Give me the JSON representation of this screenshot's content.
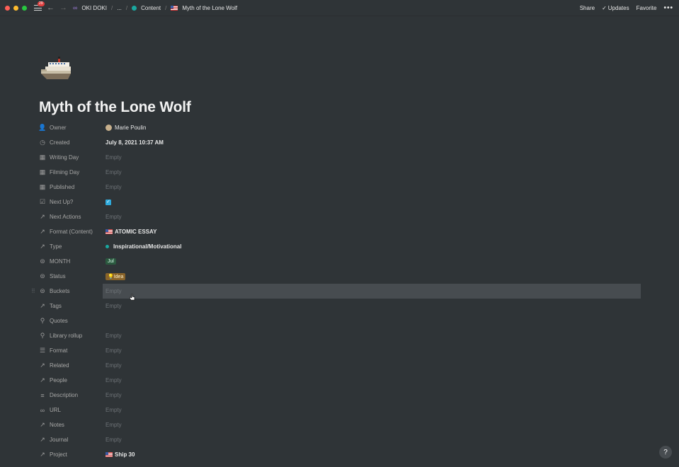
{
  "topbar": {
    "badge": "29",
    "workspace": "OKI DOKI",
    "ellipsis": "...",
    "separator": "/",
    "crumb_content": "Content",
    "crumb_page": "Myth of the Lone Wolf",
    "actions": {
      "share": "Share",
      "updates": "Updates",
      "favorite": "Favorite",
      "more": "•••"
    }
  },
  "page": {
    "icon": "ship-emoji-icon",
    "title": "Myth of the Lone Wolf"
  },
  "properties": [
    {
      "name": "Owner",
      "icon": "person-icon",
      "value": "Marie Poulin",
      "kind": "person"
    },
    {
      "name": "Created",
      "icon": "clock-icon",
      "value": "July 8, 2021 10:37 AM",
      "kind": "bold"
    },
    {
      "name": "Writing Day",
      "icon": "calendar-icon",
      "value": "Empty",
      "kind": "empty"
    },
    {
      "name": "Filming Day",
      "icon": "calendar-icon",
      "value": "Empty",
      "kind": "empty"
    },
    {
      "name": "Published",
      "icon": "calendar-icon",
      "value": "Empty",
      "kind": "empty"
    },
    {
      "name": "Next Up?",
      "icon": "checkbox-icon",
      "value": "✓",
      "kind": "checkbox"
    },
    {
      "name": "Next Actions",
      "icon": "arrow-up-right-icon",
      "value": "Empty",
      "kind": "empty"
    },
    {
      "name": "Format (Content)",
      "icon": "arrow-up-right-icon",
      "value": "ATOMIC ESSAY",
      "kind": "relation"
    },
    {
      "name": "Type",
      "icon": "arrow-up-right-icon",
      "value": "Inspirational/Motivational",
      "kind": "type"
    },
    {
      "name": "MONTH",
      "icon": "select-icon",
      "value": "Jul",
      "kind": "month"
    },
    {
      "name": "Status",
      "icon": "select-icon",
      "value": "💡Idea",
      "kind": "status"
    },
    {
      "name": "Buckets",
      "icon": "select-icon",
      "value": "Empty",
      "kind": "empty",
      "hover": true
    },
    {
      "name": "Tags",
      "icon": "arrow-up-right-icon",
      "value": "Empty",
      "kind": "empty"
    },
    {
      "name": "Quotes",
      "icon": "search-icon",
      "value": "",
      "kind": "empty"
    },
    {
      "name": "Library rollup",
      "icon": "search-icon",
      "value": "Empty",
      "kind": "empty"
    },
    {
      "name": "Format",
      "icon": "list-icon",
      "value": "Empty",
      "kind": "empty"
    },
    {
      "name": "Related",
      "icon": "arrow-up-right-icon",
      "value": "Empty",
      "kind": "empty"
    },
    {
      "name": "People",
      "icon": "arrow-up-right-icon",
      "value": "Empty",
      "kind": "empty"
    },
    {
      "name": "Description",
      "icon": "text-lines-icon",
      "value": "Empty",
      "kind": "empty"
    },
    {
      "name": "URL",
      "icon": "link-icon",
      "value": "Empty",
      "kind": "empty"
    },
    {
      "name": "Notes",
      "icon": "arrow-up-right-icon",
      "value": "Empty",
      "kind": "empty"
    },
    {
      "name": "Journal",
      "icon": "arrow-up-right-icon",
      "value": "Empty",
      "kind": "empty"
    },
    {
      "name": "Project",
      "icon": "arrow-up-right-icon",
      "value": "Ship 30",
      "kind": "relation"
    }
  ],
  "help": "?"
}
